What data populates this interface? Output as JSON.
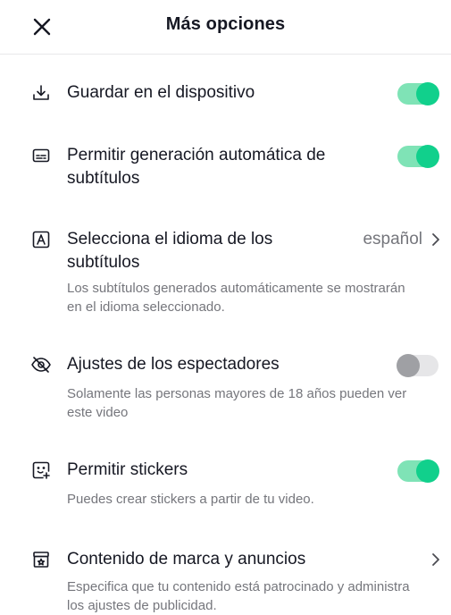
{
  "header": {
    "title": "Más opciones",
    "close_icon": "close-icon"
  },
  "options": {
    "save_device": {
      "label": "Guardar en el dispositivo",
      "icon": "download-icon",
      "enabled": true
    },
    "auto_captions": {
      "label": "Permitir generación automática de subtítulos",
      "icon": "captions-icon",
      "enabled": true
    },
    "caption_language": {
      "label": "Selecciona el idioma de los subtítulos",
      "icon": "language-icon",
      "value": "español",
      "description": "Los subtítulos generados automáticamente se mostrarán en el idioma seleccionado."
    },
    "viewer_settings": {
      "label": "Ajustes de los espectadores",
      "icon": "eye-off-icon",
      "enabled": false,
      "description": "Solamente las personas mayores de 18 años pueden ver este video"
    },
    "stickers": {
      "label": "Permitir stickers",
      "icon": "sticker-icon",
      "enabled": true,
      "description": "Puedes crear stickers a partir de tu video."
    },
    "branded_content": {
      "label": "Contenido de marca y anuncios",
      "icon": "ad-icon",
      "description": "Especifica que tu contenido está patrocinado y administra los ajustes de publicidad."
    }
  },
  "colors": {
    "toggle_on": "#11d08c",
    "toggle_on_track": "#7fe3b6",
    "toggle_off": "#9fa0a4",
    "text_secondary": "#75767c"
  }
}
